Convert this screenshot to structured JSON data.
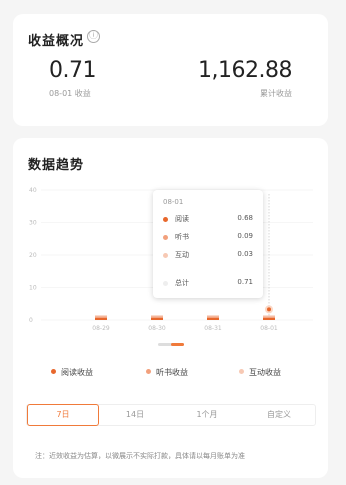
{
  "overview": {
    "title": "收益概况",
    "info_icon": "ⓘ",
    "yesterday_value": "0.71",
    "yesterday_label": "08-01 收益",
    "total_value": "1,162.88",
    "total_label": "累计收益"
  },
  "trend": {
    "title": "数据趋势",
    "tooltip": {
      "date": "08-01",
      "rows": [
        {
          "label": "阅读",
          "value": "0.68",
          "color": "#e8672c"
        },
        {
          "label": "听书",
          "value": "0.09",
          "color": "#f2a07c"
        },
        {
          "label": "互动",
          "value": "0.03",
          "color": "#f7c9b4"
        },
        {
          "label": "总计",
          "value": "0.71",
          "color": "#eeeeee"
        }
      ]
    },
    "legend": [
      {
        "label": "阅读收益",
        "color": "#e8672c"
      },
      {
        "label": "听书收益",
        "color": "#f2a07c"
      },
      {
        "label": "互动收益",
        "color": "#f7c9b4"
      }
    ],
    "tabs": [
      "7日",
      "14日",
      "1个月",
      "自定义"
    ],
    "active_tab": "7日",
    "note": "注：近效收益为估算，以微展示不实际打款，具体请以每月账单为准"
  },
  "chart_data": {
    "type": "bar",
    "categories": [
      "08-29",
      "08-30",
      "08-31",
      "08-01"
    ],
    "series": [
      {
        "name": "阅读收益",
        "values": [
          0.7,
          0.7,
          0.7,
          0.68
        ]
      },
      {
        "name": "听书收益",
        "values": [
          0.08,
          0.08,
          0.08,
          0.09
        ]
      },
      {
        "name": "互动收益",
        "values": [
          0.03,
          0.03,
          0.03,
          0.03
        ]
      }
    ],
    "yticks": [
      "40",
      "30",
      "20",
      "10",
      "0"
    ],
    "ylim": [
      0,
      40
    ],
    "grid": true,
    "highlight_category": "08-01"
  }
}
